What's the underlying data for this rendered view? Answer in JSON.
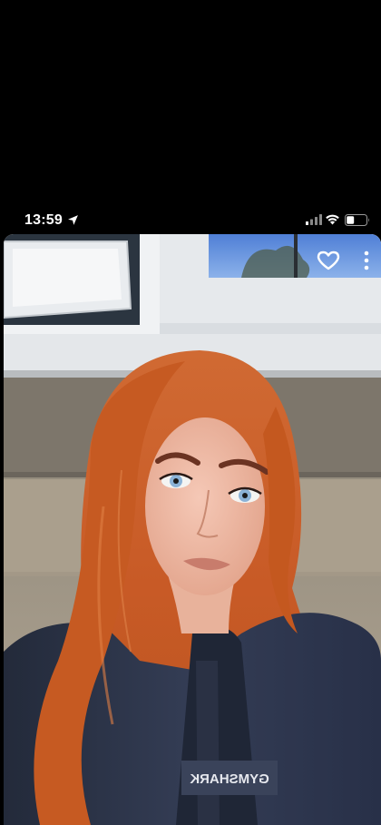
{
  "status_bar": {
    "time": "13:59",
    "icons": [
      "location-arrow-icon",
      "cellular-signal-icon",
      "wifi-icon",
      "battery-icon"
    ]
  },
  "photo_viewer": {
    "actions": [
      "heart-icon",
      "more-vertical-icon"
    ],
    "shirt_print_mirrored": "GYMSHARK",
    "colors": {
      "hair": "#c8602a",
      "jacket": "#2a3245",
      "wall_stone": "#9d8f7c",
      "window_frame": "#e8ebee"
    }
  }
}
